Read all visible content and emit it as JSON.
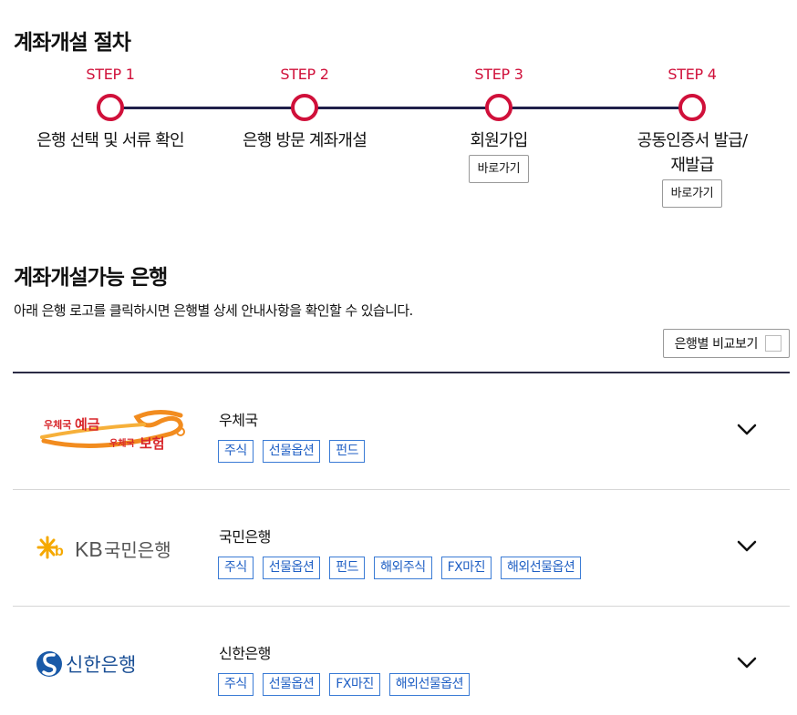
{
  "page": {
    "title": "계좌개설 절차",
    "section_title": "계좌개설가능 은행",
    "description": "아래 은행 로고를 클릭하시면 은행별 상세 안내사항을 확인할 수 있습니다.",
    "compare_label": "은행별 비교보기"
  },
  "colors": {
    "accent": "#d0103a",
    "line": "#1f1f4a",
    "tag": "#3a7bd5"
  },
  "steps": [
    {
      "num": "STEP 1",
      "label": "은행 선택 및 서류 확인",
      "label2": "",
      "button": ""
    },
    {
      "num": "STEP 2",
      "label": "은행 방문 계좌개설",
      "label2": "",
      "button": ""
    },
    {
      "num": "STEP 3",
      "label": "회원가입",
      "label2": "",
      "button": "바로가기"
    },
    {
      "num": "STEP 4",
      "label": "공동인증서 발급/",
      "label2": "재발급",
      "button": "바로가기"
    }
  ],
  "banks": [
    {
      "name": "우체국",
      "logo_text": [
        "우체국",
        "예금",
        "우체국",
        "보험"
      ],
      "tags": [
        "주식",
        "선물옵션",
        "펀드"
      ]
    },
    {
      "name": "국민은행",
      "logo_text": [
        "KB",
        "국민은행"
      ],
      "tags": [
        "주식",
        "선물옵션",
        "펀드",
        "해외주식",
        "FX마진",
        "해외선물옵션"
      ]
    },
    {
      "name": "신한은행",
      "logo_text": [
        "신한은행"
      ],
      "tags": [
        "주식",
        "선물옵션",
        "FX마진",
        "해외선물옵션"
      ]
    }
  ]
}
